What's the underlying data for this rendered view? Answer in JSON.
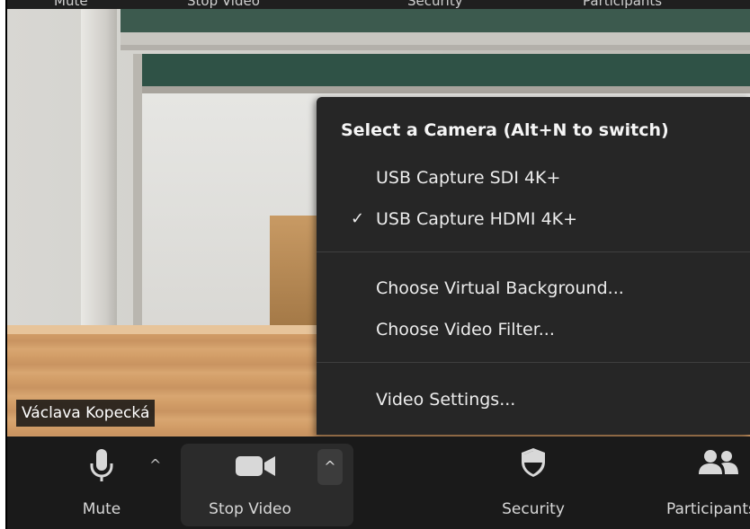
{
  "top_bar": {
    "items": [
      "Mute",
      "Stop Video",
      "Security",
      "Participants"
    ]
  },
  "video": {
    "participant_name": "Václava Kopecká"
  },
  "camera_menu": {
    "title": "Select a Camera (Alt+N to switch)",
    "cameras": [
      {
        "label": "USB Capture SDI 4K+",
        "selected": false
      },
      {
        "label": "USB Capture HDMI 4K+",
        "selected": true
      }
    ],
    "check_mark": "✓",
    "options": [
      {
        "label": "Choose Virtual Background..."
      },
      {
        "label": "Choose Video Filter..."
      }
    ],
    "settings": {
      "label": "Video Settings..."
    }
  },
  "toolbar": {
    "mute_label": "Mute",
    "stop_video_label": "Stop Video",
    "security_label": "Security",
    "participants_label": "Participants",
    "caret": "^",
    "icons": {
      "mute": "microphone-icon",
      "video": "video-camera-icon",
      "security": "shield-icon",
      "participants": "participants-icon"
    }
  },
  "colors": {
    "toolbar_bg": "#1a1a1a",
    "menu_bg": "#262626",
    "text": "#ececec"
  }
}
